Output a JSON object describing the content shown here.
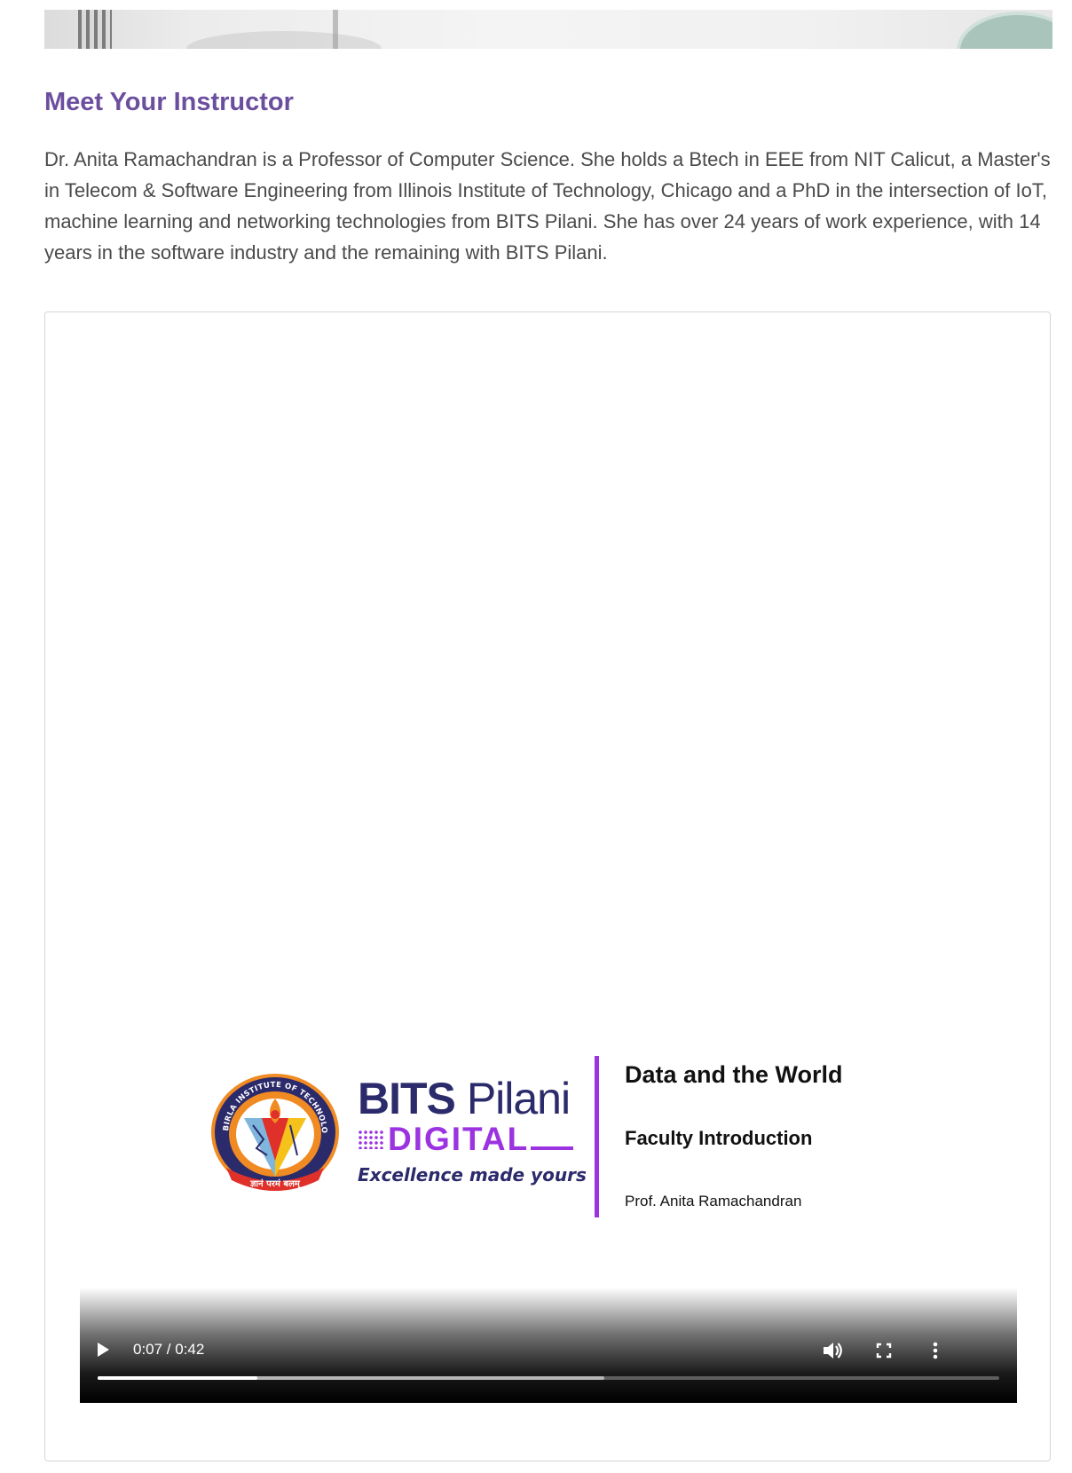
{
  "section": {
    "title": "Meet Your Instructor",
    "bio": "Dr. Anita Ramachandran is a Professor of Computer Science. She holds a Btech in EEE from NIT Calicut, a Master's in Telecom & Software Engineering from Illinois Institute of Technology, Chicago and a PhD in the intersection of IoT, machine learning and networking technologies from BITS Pilani. She has over 24 years of work experience, with 14 years in the software industry and the remaining with BITS Pilani."
  },
  "slide": {
    "emblem_ring_text": "BIRLA INSTITUTE OF TECHNOLOGY & SCIENCE PILANI",
    "emblem_motto": "ज्ञानं परमं बलम्",
    "brand_bits": "BITS",
    "brand_pilani": "Pilani",
    "brand_digital": "DIGITAL",
    "brand_tagline": "Excellence made yours",
    "title": "Data and the World",
    "subtitle": "Faculty Introduction",
    "presenter": "Prof. Anita Ramachandran",
    "divider_color": "#9b33e0",
    "brand_color": "#2b2a6b"
  },
  "player": {
    "current_time": "0:07",
    "duration": "0:42",
    "time_display": "0:07 / 0:42",
    "played_fraction": 0.177,
    "buffered_fraction": 0.562,
    "icons": [
      "play-icon",
      "volume-icon",
      "fullscreen-icon",
      "more-options-icon"
    ]
  },
  "colors": {
    "heading": "#6b4f9e",
    "body_text": "#4a4a4a"
  }
}
